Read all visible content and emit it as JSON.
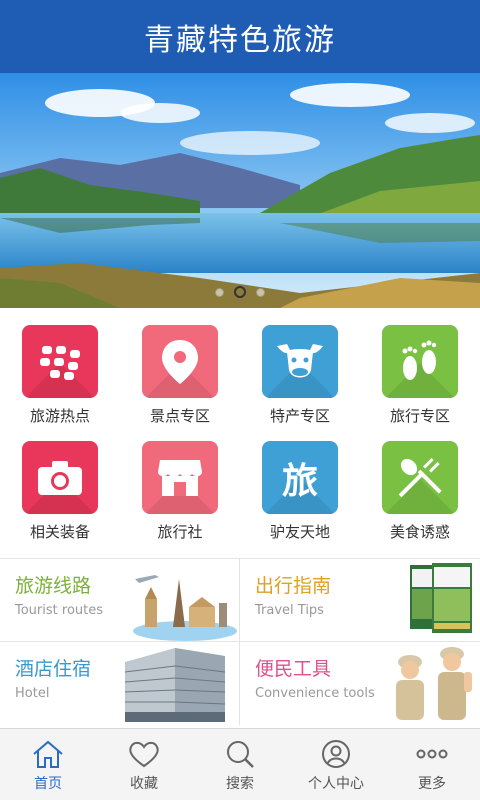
{
  "header": {
    "title": "青藏特色旅游"
  },
  "banner": {
    "dots": 3,
    "active_dot": 1
  },
  "grid": {
    "items": [
      {
        "label": "旅游热点",
        "icon": "blackberry-dots-icon",
        "color": "#e8375a"
      },
      {
        "label": "景点专区",
        "icon": "map-pin-icon",
        "color": "#f06a7b"
      },
      {
        "label": "特产专区",
        "icon": "yak-head-icon",
        "color": "#3fa0d6"
      },
      {
        "label": "旅行专区",
        "icon": "footprints-icon",
        "color": "#7ac143"
      },
      {
        "label": "相关装备",
        "icon": "camera-icon",
        "color": "#e8375a"
      },
      {
        "label": "旅行社",
        "icon": "storefront-icon",
        "color": "#f06a7b"
      },
      {
        "label": "驴友天地",
        "icon": "travel-character-icon",
        "color": "#3fa0d6",
        "glyph": "旅"
      },
      {
        "label": "美食诱惑",
        "icon": "spoon-fork-icon",
        "color": "#7ac143"
      }
    ]
  },
  "promos": [
    {
      "title": "旅游线路",
      "subtitle": "Tourist routes",
      "color": "#7bb13a"
    },
    {
      "title": "出行指南",
      "subtitle": "Travel Tips",
      "color": "#e0a020"
    },
    {
      "title": "酒店住宿",
      "subtitle": "Hotel",
      "color": "#3a98d0"
    },
    {
      "title": "便民工具",
      "subtitle": "Convenience tools",
      "color": "#e04f8e"
    }
  ],
  "tabs": [
    {
      "label": "首页",
      "icon": "home-icon"
    },
    {
      "label": "收藏",
      "icon": "heart-icon"
    },
    {
      "label": "搜索",
      "icon": "search-icon"
    },
    {
      "label": "个人中心",
      "icon": "user-icon"
    },
    {
      "label": "更多",
      "icon": "more-dots-icon"
    }
  ],
  "active_tab": 0
}
